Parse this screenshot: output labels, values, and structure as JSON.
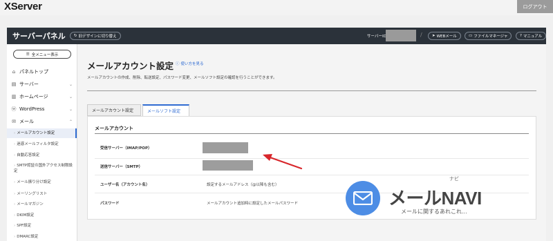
{
  "header": {
    "logo": "XServer",
    "logout_label": "ログアウト"
  },
  "panel": {
    "title": "サーバーパネル",
    "design_toggle": "旧デザインに切り替え",
    "server_id_label": "サーバーID",
    "links": [
      "WEBメール",
      "ファイルマネージャ",
      "マニュアル"
    ]
  },
  "sidebar": {
    "menu_button": "全メニュー表示",
    "items": [
      {
        "label": "パネルトップ",
        "icon": "home-icon"
      },
      {
        "label": "サーバー",
        "icon": "server-icon"
      },
      {
        "label": "ホームページ",
        "icon": "homepage-icon"
      },
      {
        "label": "WordPress",
        "icon": "wordpress-icon"
      },
      {
        "label": "メール",
        "icon": "mail-icon"
      }
    ],
    "mail_submenu": [
      "メールアカウント設定",
      "迷惑メールフィルタ設定",
      "自動応答設定",
      "SMTP認証の国外アクセス制限設定",
      "メール振り分け設定",
      "メーリングリスト",
      "メールマガジン",
      "DKIM設定",
      "SPF設定",
      "DMARC設定"
    ]
  },
  "main": {
    "title": "メールアカウント設定",
    "howto": "使い方を見る",
    "description": "メールアカウントの作成、削除、転送設定、パスワード変更、メールソフト設定の確認を行うことができます。",
    "tabs": [
      {
        "label": "メールアカウント設定",
        "active": false
      },
      {
        "label": "メールソフト設定",
        "active": true
      }
    ],
    "card": {
      "title": "メールアカウント",
      "rows": [
        {
          "label": "受信サーバー（IMAP/POP）",
          "value": ""
        },
        {
          "label": "送信サーバー（SMTP）",
          "value": ""
        },
        {
          "label": "ユーザー名（アカウント名）",
          "value": "設定するメールアドレス（@以降も含む）"
        },
        {
          "label": "パスワード",
          "value": "メールアカウント追加時に設定したメールパスワード"
        }
      ]
    }
  },
  "watermark": {
    "brand": "メールNAVI",
    "ruby": "ナビ",
    "tagline": "メールに関するあれこれ..."
  },
  "colors": {
    "panel_bar": "#2b323a",
    "accent": "#2f6bd2",
    "arrow": "#d8262b",
    "watermark_circle": "#4d8de5"
  }
}
